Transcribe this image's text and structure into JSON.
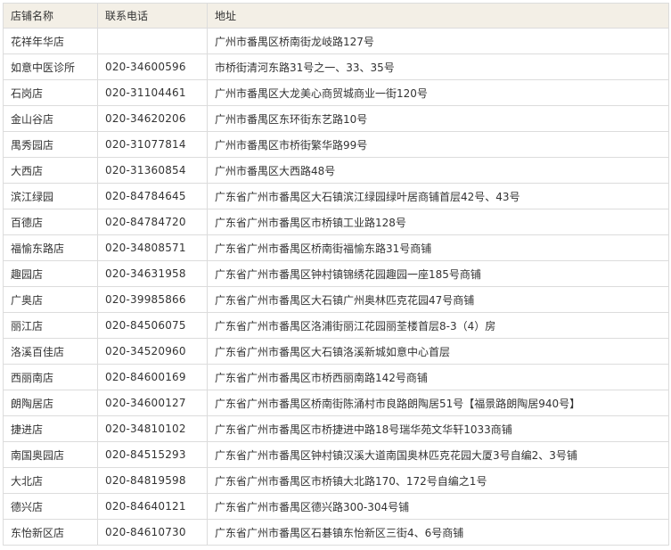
{
  "table": {
    "headers": [
      "店铺名称",
      "联系电话",
      "地址"
    ],
    "rows": [
      {
        "name": "花祥年华店",
        "phone": "",
        "address": "广州市番禺区桥南街龙岐路127号"
      },
      {
        "name": "如意中医诊所",
        "phone": "020-34600596",
        "address": "市桥街清河东路31号之一、33、35号"
      },
      {
        "name": "石岗店",
        "phone": "020-31104461",
        "address": "广州市番禺区大龙美心商贸城商业一街120号"
      },
      {
        "name": "金山谷店",
        "phone": "020-34620206",
        "address": "广州市番禺区东环街东艺路10号"
      },
      {
        "name": "禺秀园店",
        "phone": "020-31077814",
        "address": "广州市番禺区市桥街繁华路99号"
      },
      {
        "name": "大西店",
        "phone": "020-31360854",
        "address": "广州市番禺区大西路48号"
      },
      {
        "name": "滨江绿园",
        "phone": "020-84784645",
        "address": "广东省广州市番禺区大石镇滨江绿园绿叶居商铺首层42号、43号"
      },
      {
        "name": "百德店",
        "phone": "020-84784720",
        "address": "广东省广州市番禺区市桥镇工业路128号"
      },
      {
        "name": "福愉东路店",
        "phone": "020-34808571",
        "address": "广东省广州市番禺区桥南街福愉东路31号商铺"
      },
      {
        "name": "趣园店",
        "phone": "020-34631958",
        "address": "广东省广州市番禺区钟村镇锦绣花园趣园一座185号商铺"
      },
      {
        "name": "广奥店",
        "phone": "020-39985866",
        "address": "广东省广州市番禺区大石镇广州奥林匹克花园47号商铺"
      },
      {
        "name": "丽江店",
        "phone": "020-84506075",
        "address": "广东省广州市番禺区洛浦街丽江花园丽荃楼首层8-3（4）房"
      },
      {
        "name": "洛溪百佳店",
        "phone": "020-34520960",
        "address": "广东省广州市番禺区大石镇洛溪新城如意中心首层"
      },
      {
        "name": "西丽南店",
        "phone": "020-84600169",
        "address": "广东省广州市番禺区市桥西丽南路142号商铺"
      },
      {
        "name": "朗陶居店",
        "phone": "020-34600127",
        "address": "广东省广州市番禺区桥南街陈涌村市良路朗陶居51号【福景路朗陶居940号】"
      },
      {
        "name": "捷进店",
        "phone": "020-34810102",
        "address": "广东省广州市番禺区市桥捷进中路18号瑞华苑文华轩1033商铺"
      },
      {
        "name": "南国奥园店",
        "phone": "020-84515293",
        "address": "广东省广州市番禺区钟村镇汉溪大道南国奥林匹克花园大厦3号自编2、3号铺"
      },
      {
        "name": "大北店",
        "phone": "020-84819598",
        "address": "广东省广州市番禺区市桥镇大北路170、172号自编之1号"
      },
      {
        "name": "德兴店",
        "phone": "020-84640121",
        "address": "广东省广州市番禺区德兴路300-304号铺"
      },
      {
        "name": "东怡新区店",
        "phone": "020-84610730",
        "address": "广东省广州市番禺区石碁镇东怡新区三街4、6号商铺"
      }
    ]
  }
}
